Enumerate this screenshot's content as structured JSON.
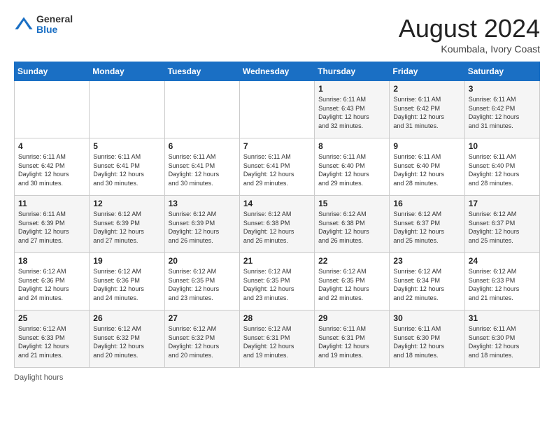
{
  "header": {
    "logo_general": "General",
    "logo_blue": "Blue",
    "month_year": "August 2024",
    "location": "Koumbala, Ivory Coast"
  },
  "days_of_week": [
    "Sunday",
    "Monday",
    "Tuesday",
    "Wednesday",
    "Thursday",
    "Friday",
    "Saturday"
  ],
  "weeks": [
    [
      {
        "day": "",
        "info": ""
      },
      {
        "day": "",
        "info": ""
      },
      {
        "day": "",
        "info": ""
      },
      {
        "day": "",
        "info": ""
      },
      {
        "day": "1",
        "info": "Sunrise: 6:11 AM\nSunset: 6:43 PM\nDaylight: 12 hours\nand 32 minutes."
      },
      {
        "day": "2",
        "info": "Sunrise: 6:11 AM\nSunset: 6:42 PM\nDaylight: 12 hours\nand 31 minutes."
      },
      {
        "day": "3",
        "info": "Sunrise: 6:11 AM\nSunset: 6:42 PM\nDaylight: 12 hours\nand 31 minutes."
      }
    ],
    [
      {
        "day": "4",
        "info": "Sunrise: 6:11 AM\nSunset: 6:42 PM\nDaylight: 12 hours\nand 30 minutes."
      },
      {
        "day": "5",
        "info": "Sunrise: 6:11 AM\nSunset: 6:41 PM\nDaylight: 12 hours\nand 30 minutes."
      },
      {
        "day": "6",
        "info": "Sunrise: 6:11 AM\nSunset: 6:41 PM\nDaylight: 12 hours\nand 30 minutes."
      },
      {
        "day": "7",
        "info": "Sunrise: 6:11 AM\nSunset: 6:41 PM\nDaylight: 12 hours\nand 29 minutes."
      },
      {
        "day": "8",
        "info": "Sunrise: 6:11 AM\nSunset: 6:40 PM\nDaylight: 12 hours\nand 29 minutes."
      },
      {
        "day": "9",
        "info": "Sunrise: 6:11 AM\nSunset: 6:40 PM\nDaylight: 12 hours\nand 28 minutes."
      },
      {
        "day": "10",
        "info": "Sunrise: 6:11 AM\nSunset: 6:40 PM\nDaylight: 12 hours\nand 28 minutes."
      }
    ],
    [
      {
        "day": "11",
        "info": "Sunrise: 6:11 AM\nSunset: 6:39 PM\nDaylight: 12 hours\nand 27 minutes."
      },
      {
        "day": "12",
        "info": "Sunrise: 6:12 AM\nSunset: 6:39 PM\nDaylight: 12 hours\nand 27 minutes."
      },
      {
        "day": "13",
        "info": "Sunrise: 6:12 AM\nSunset: 6:39 PM\nDaylight: 12 hours\nand 26 minutes."
      },
      {
        "day": "14",
        "info": "Sunrise: 6:12 AM\nSunset: 6:38 PM\nDaylight: 12 hours\nand 26 minutes."
      },
      {
        "day": "15",
        "info": "Sunrise: 6:12 AM\nSunset: 6:38 PM\nDaylight: 12 hours\nand 26 minutes."
      },
      {
        "day": "16",
        "info": "Sunrise: 6:12 AM\nSunset: 6:37 PM\nDaylight: 12 hours\nand 25 minutes."
      },
      {
        "day": "17",
        "info": "Sunrise: 6:12 AM\nSunset: 6:37 PM\nDaylight: 12 hours\nand 25 minutes."
      }
    ],
    [
      {
        "day": "18",
        "info": "Sunrise: 6:12 AM\nSunset: 6:36 PM\nDaylight: 12 hours\nand 24 minutes."
      },
      {
        "day": "19",
        "info": "Sunrise: 6:12 AM\nSunset: 6:36 PM\nDaylight: 12 hours\nand 24 minutes."
      },
      {
        "day": "20",
        "info": "Sunrise: 6:12 AM\nSunset: 6:35 PM\nDaylight: 12 hours\nand 23 minutes."
      },
      {
        "day": "21",
        "info": "Sunrise: 6:12 AM\nSunset: 6:35 PM\nDaylight: 12 hours\nand 23 minutes."
      },
      {
        "day": "22",
        "info": "Sunrise: 6:12 AM\nSunset: 6:35 PM\nDaylight: 12 hours\nand 22 minutes."
      },
      {
        "day": "23",
        "info": "Sunrise: 6:12 AM\nSunset: 6:34 PM\nDaylight: 12 hours\nand 22 minutes."
      },
      {
        "day": "24",
        "info": "Sunrise: 6:12 AM\nSunset: 6:33 PM\nDaylight: 12 hours\nand 21 minutes."
      }
    ],
    [
      {
        "day": "25",
        "info": "Sunrise: 6:12 AM\nSunset: 6:33 PM\nDaylight: 12 hours\nand 21 minutes."
      },
      {
        "day": "26",
        "info": "Sunrise: 6:12 AM\nSunset: 6:32 PM\nDaylight: 12 hours\nand 20 minutes."
      },
      {
        "day": "27",
        "info": "Sunrise: 6:12 AM\nSunset: 6:32 PM\nDaylight: 12 hours\nand 20 minutes."
      },
      {
        "day": "28",
        "info": "Sunrise: 6:12 AM\nSunset: 6:31 PM\nDaylight: 12 hours\nand 19 minutes."
      },
      {
        "day": "29",
        "info": "Sunrise: 6:11 AM\nSunset: 6:31 PM\nDaylight: 12 hours\nand 19 minutes."
      },
      {
        "day": "30",
        "info": "Sunrise: 6:11 AM\nSunset: 6:30 PM\nDaylight: 12 hours\nand 18 minutes."
      },
      {
        "day": "31",
        "info": "Sunrise: 6:11 AM\nSunset: 6:30 PM\nDaylight: 12 hours\nand 18 minutes."
      }
    ]
  ],
  "footer": {
    "daylight_label": "Daylight hours"
  }
}
